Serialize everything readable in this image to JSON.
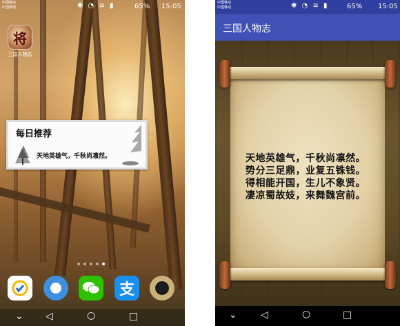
{
  "left_screen": {
    "status_bar": {
      "carrier_line1": "中国移动",
      "carrier_line2": "中国移动",
      "battery": "65%",
      "time": "15:05"
    },
    "app_icon": {
      "glyph": "将",
      "label": "三国人物志"
    },
    "widget": {
      "title": "每日推荐",
      "poem": "天地英雄气，千秋尚凛然。"
    },
    "page_dots": 5,
    "active_dot": 4,
    "dock_apps": [
      {
        "icon": "checkmark-app-icon"
      },
      {
        "icon": "cloud-app-icon"
      },
      {
        "icon": "wechat-icon"
      },
      {
        "icon": "alipay-icon",
        "glyph": "支"
      },
      {
        "icon": "clock-app-icon"
      }
    ]
  },
  "right_screen": {
    "status_bar": {
      "carrier_line1": "中国移动",
      "carrier_line2": "中国移动",
      "battery": "65%",
      "time": "15:05"
    },
    "app_bar": {
      "title": "三国人物志"
    },
    "poem_lines": [
      "天地英雄气，千秋尚凛然。",
      "势分三足鼎，业复五铢钱。",
      "得相能开国，生儿不象贤。",
      "凄凉蜀故妓，来舞魏宫前。"
    ]
  },
  "navigation_bar": {
    "back": "◁",
    "home": "○",
    "recents": "□",
    "down": "⌄"
  }
}
